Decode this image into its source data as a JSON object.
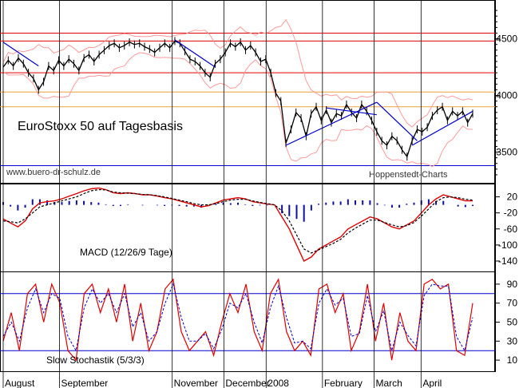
{
  "chart_data": [
    {
      "type": "line",
      "panel": "price",
      "title": "EuroStoxx 50 auf Tagesbasis",
      "yticks": [
        3500,
        4000,
        4500
      ],
      "ylim": [
        3250,
        4800
      ],
      "hlines_red": [
        4550,
        4480,
        4200
      ],
      "hlines_orange": [
        4030,
        3900
      ],
      "hline_blue": 3380,
      "series": [
        {
          "values": [
            4250,
            4310,
            4260,
            4330,
            4280,
            4200,
            4150,
            4050,
            4120,
            4260,
            4220,
            4310,
            4260,
            4320,
            4280,
            4220,
            4330,
            4360,
            4300,
            4360,
            4400,
            4440,
            4460,
            4420,
            4440,
            4470,
            4450,
            4460,
            4430,
            4410,
            4380,
            4420,
            4460,
            4420,
            4480,
            4460,
            4390,
            4320,
            4300,
            4260,
            4200,
            4160,
            4280,
            4320,
            4380,
            4460,
            4430,
            4470,
            4400,
            4440,
            4380,
            4300,
            4320,
            4200,
            4020,
            3950,
            3580,
            3700,
            3850,
            3800,
            3640,
            3840,
            3900,
            3780,
            3870,
            3760,
            3840,
            3820,
            3920,
            3850,
            3800,
            3920,
            3860,
            3780,
            3680,
            3600,
            3560,
            3640,
            3600,
            3520,
            3460,
            3600,
            3700,
            3680,
            3720,
            3820,
            3870,
            3900,
            3780,
            3860,
            3820,
            3860,
            3760,
            3840
          ]
        }
      ],
      "annotations": [
        "www.buero-dr-schulz.de",
        "Hoppenstedt-Charts"
      ]
    },
    {
      "type": "line",
      "panel": "macd",
      "title": "MACD (12/26/9 Tage)",
      "yticks": [
        20,
        -20,
        -60,
        -100,
        -140
      ],
      "ytick_labels": [
        "20",
        "-20",
        "-60",
        "-100",
        "-140"
      ],
      "ylim": [
        -160,
        45
      ],
      "series": [
        {
          "values": [
            -35,
            -45,
            -55,
            -40,
            -10,
            5,
            8,
            10,
            15,
            22,
            28,
            35,
            40,
            42,
            38,
            30,
            28,
            30,
            28,
            25,
            25,
            22,
            18,
            15,
            10,
            5,
            0,
            -5,
            -2,
            5,
            12,
            15,
            18,
            15,
            8,
            5,
            2,
            0,
            -30,
            -60,
            -100,
            -140,
            -130,
            -110,
            -100,
            -90,
            -80,
            -60,
            -50,
            -40,
            -30,
            -35,
            -45,
            -55,
            -60,
            -50,
            -40,
            -20,
            0,
            15,
            25,
            20,
            15,
            10,
            10
          ]
        },
        {
          "values": [
            -40,
            -42,
            -45,
            -35,
            -20,
            -5,
            0,
            5,
            10,
            15,
            20,
            28,
            35,
            38,
            37,
            32,
            30,
            29,
            28,
            26,
            25,
            23,
            20,
            16,
            12,
            8,
            3,
            0,
            0,
            3,
            8,
            12,
            14,
            14,
            10,
            6,
            3,
            0,
            -15,
            -40,
            -75,
            -110,
            -120,
            -112,
            -104,
            -96,
            -86,
            -70,
            -58,
            -48,
            -38,
            -38,
            -44,
            -50,
            -55,
            -52,
            -44,
            -28,
            -10,
            8,
            18,
            20,
            18,
            14,
            12
          ]
        }
      ]
    },
    {
      "type": "line",
      "panel": "stochastic",
      "title": "Slow Stochastik (5/3/3)",
      "yticks": [
        90,
        70,
        50,
        30,
        10
      ],
      "ylim": [
        0,
        100
      ],
      "hlines_blue": [
        80,
        20
      ],
      "series": [
        {
          "values": [
            30,
            60,
            20,
            80,
            90,
            50,
            90,
            70,
            20,
            10,
            80,
            90,
            60,
            85,
            50,
            90,
            30,
            70,
            20,
            40,
            85,
            95,
            40,
            20,
            30,
            40,
            15,
            50,
            80,
            60,
            90,
            40,
            20,
            80,
            95,
            40,
            20,
            30,
            15,
            85,
            90,
            60,
            80,
            20,
            40,
            90,
            30,
            70,
            10,
            60,
            30,
            20,
            90,
            95,
            85,
            90,
            20,
            15,
            70
          ]
        },
        {
          "values": [
            35,
            50,
            30,
            65,
            85,
            60,
            80,
            75,
            35,
            20,
            65,
            85,
            70,
            80,
            60,
            80,
            45,
            60,
            30,
            40,
            70,
            90,
            55,
            30,
            30,
            38,
            22,
            42,
            70,
            65,
            80,
            50,
            28,
            65,
            88,
            55,
            28,
            30,
            22,
            70,
            85,
            68,
            75,
            35,
            38,
            78,
            40,
            62,
            20,
            50,
            36,
            25,
            78,
            90,
            88,
            88,
            35,
            20,
            55
          ]
        }
      ]
    }
  ],
  "x_axis": {
    "labels": [
      "August",
      "September",
      "November",
      "December",
      "2008",
      "February",
      "March",
      "April"
    ]
  },
  "colors": {
    "price": "#000000",
    "resistance_lines": "#e00000",
    "orange_lines": "#e8a23a",
    "blue_lines": "#0000cc",
    "bollinger": "#ff9a9a",
    "macd_line": "#e00000",
    "macd_hist": "#1010a0"
  }
}
